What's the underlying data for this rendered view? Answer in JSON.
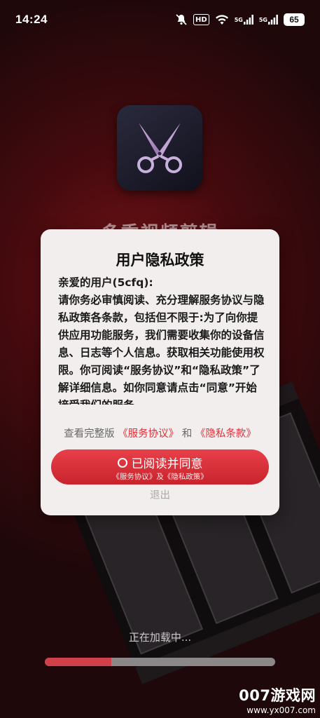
{
  "status_bar": {
    "time": "14:24",
    "icons": [
      "mute-icon",
      "hd-icon",
      "wifi-icon",
      "signal-5g-icon",
      "signal-5g-icon",
      "battery-icon"
    ],
    "hd_label": "HD",
    "network_1": "5G",
    "network_2": "5G",
    "battery_level": "65"
  },
  "app": {
    "name": "多秀视频剪辑",
    "icon": "scissors-icon"
  },
  "dialog": {
    "title": "用户隐私政策",
    "greeting": "亲爱的用户(5cfq):",
    "body": "请你务必审慎阅读、充分理解服务协议与隐私政策各条款，包括但不限于:为了向你提供应用功能服务，我们需要收集你的设备信息、日志等个人信息。获取相关功能使用权限。你可阅读“服务协议”和“隐私政策”了解详细信息。如你同意请点击“同意”开始接受我们的服务。",
    "links_prefix": "查看完整版",
    "service_link": "《服务协议》",
    "links_and": "和",
    "privacy_link": "《隐私条款》",
    "agree_label": "已阅读并同意",
    "agree_sub": "《服务协议》及《隐私政策》",
    "exit_label": "退出"
  },
  "loading": {
    "text": "正在加载中...",
    "progress": 0.29
  },
  "colors": {
    "accent": "#e0303a",
    "button": "#d3313a",
    "dialog_bg": "#f2eeed"
  },
  "watermark": {
    "main": "007游戏网",
    "sub": "www.yx007.com"
  }
}
